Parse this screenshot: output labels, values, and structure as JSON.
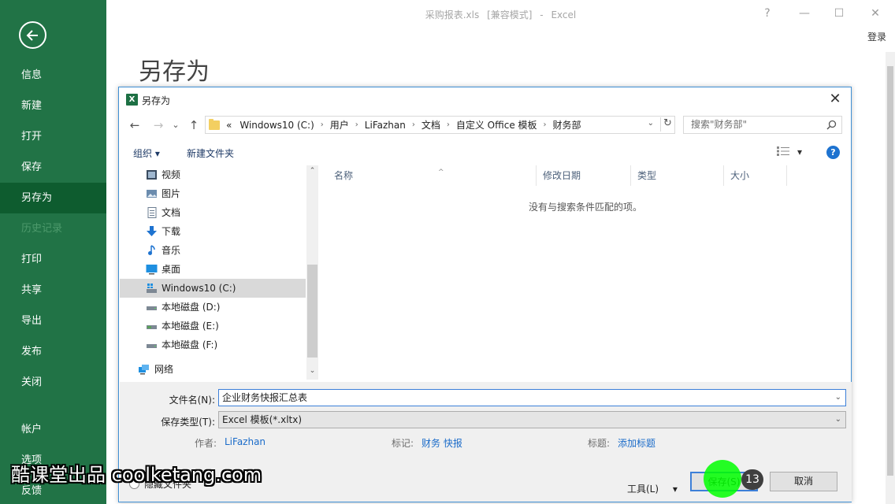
{
  "window": {
    "file_name": "采购报表.xls",
    "mode": "[兼容模式]",
    "separator": "-",
    "app_name": "Excel",
    "help_label": "?",
    "minimize_label": "—",
    "maximize_label": "☐",
    "close_label": "✕",
    "login": "登录"
  },
  "sidebar": {
    "items": [
      {
        "label": "信息"
      },
      {
        "label": "新建"
      },
      {
        "label": "打开"
      },
      {
        "label": "保存"
      },
      {
        "label": "另存为",
        "active": true
      },
      {
        "label": "历史记录",
        "disabled": true
      },
      {
        "label": "打印"
      },
      {
        "label": "共享"
      },
      {
        "label": "导出"
      },
      {
        "label": "发布"
      },
      {
        "label": "关闭"
      },
      {
        "label": "帐户"
      },
      {
        "label": "选项"
      },
      {
        "label": "反馈"
      }
    ]
  },
  "backstage": {
    "title": "另存为"
  },
  "dialog": {
    "icon_letter": "X",
    "title": "另存为",
    "close": "✕",
    "nav": {
      "back": "←",
      "forward": "→",
      "recent": "⌄",
      "up": "↑"
    },
    "address": {
      "prefix": "«",
      "crumbs": [
        "Windows10 (C:)",
        "用户",
        "LiFazhan",
        "文档",
        "自定义 Office 模板",
        "财务部"
      ],
      "separator": "›",
      "dropdown": "⌄",
      "refresh": "↻"
    },
    "search_placeholder": "搜索\"财务部\"",
    "toolbar": {
      "organize": "组织 ▾",
      "new_folder": "新建文件夹",
      "view_dd": "▾",
      "help": "?"
    },
    "tree": [
      {
        "label": "视频",
        "icon": "video-icon"
      },
      {
        "label": "图片",
        "icon": "pictures-icon"
      },
      {
        "label": "文档",
        "icon": "documents-icon"
      },
      {
        "label": "下载",
        "icon": "download-icon"
      },
      {
        "label": "音乐",
        "icon": "music-icon"
      },
      {
        "label": "桌面",
        "icon": "desktop-icon"
      },
      {
        "label": "Windows10 (C:)",
        "icon": "system-drive-icon",
        "selected": true
      },
      {
        "label": "本地磁盘 (D:)",
        "icon": "drive-icon"
      },
      {
        "label": "本地磁盘 (E:)",
        "icon": "drive-icon"
      },
      {
        "label": "本地磁盘 (F:)",
        "icon": "drive-icon"
      },
      {
        "label": "网络",
        "icon": "network-icon"
      }
    ],
    "scroll": {
      "up": "⌃",
      "down": "⌄"
    },
    "columns": [
      "名称",
      "修改日期",
      "类型",
      "大小"
    ],
    "sort_caret": "^",
    "empty_message": "没有与搜索条件匹配的项。",
    "filename_label": "文件名(N):",
    "filename_value": "企业财务快报汇总表",
    "filetype_label": "保存类型(T):",
    "filetype_value": "Excel 模板(*.xltx)",
    "field_dropdown": "⌄",
    "meta": {
      "author_label": "作者:",
      "author_value": "LiFazhan",
      "tags_label": "标记:",
      "tags_value": "财务 快报",
      "title_label": "标题:",
      "title_value": "添加标题"
    },
    "hide_folders": "隐藏文件夹",
    "tools": "工具(L)",
    "tools_dd": "▾",
    "save": "保存(S)",
    "cancel": "取消"
  },
  "overlay": {
    "step": "13",
    "watermark": "酷课堂出品 coolketang.com"
  },
  "colors": {
    "excel_green": "#217346",
    "active_green": "#0e5c2f",
    "accent_blue": "#3c7fd8",
    "link_blue": "#1a6bc9"
  }
}
